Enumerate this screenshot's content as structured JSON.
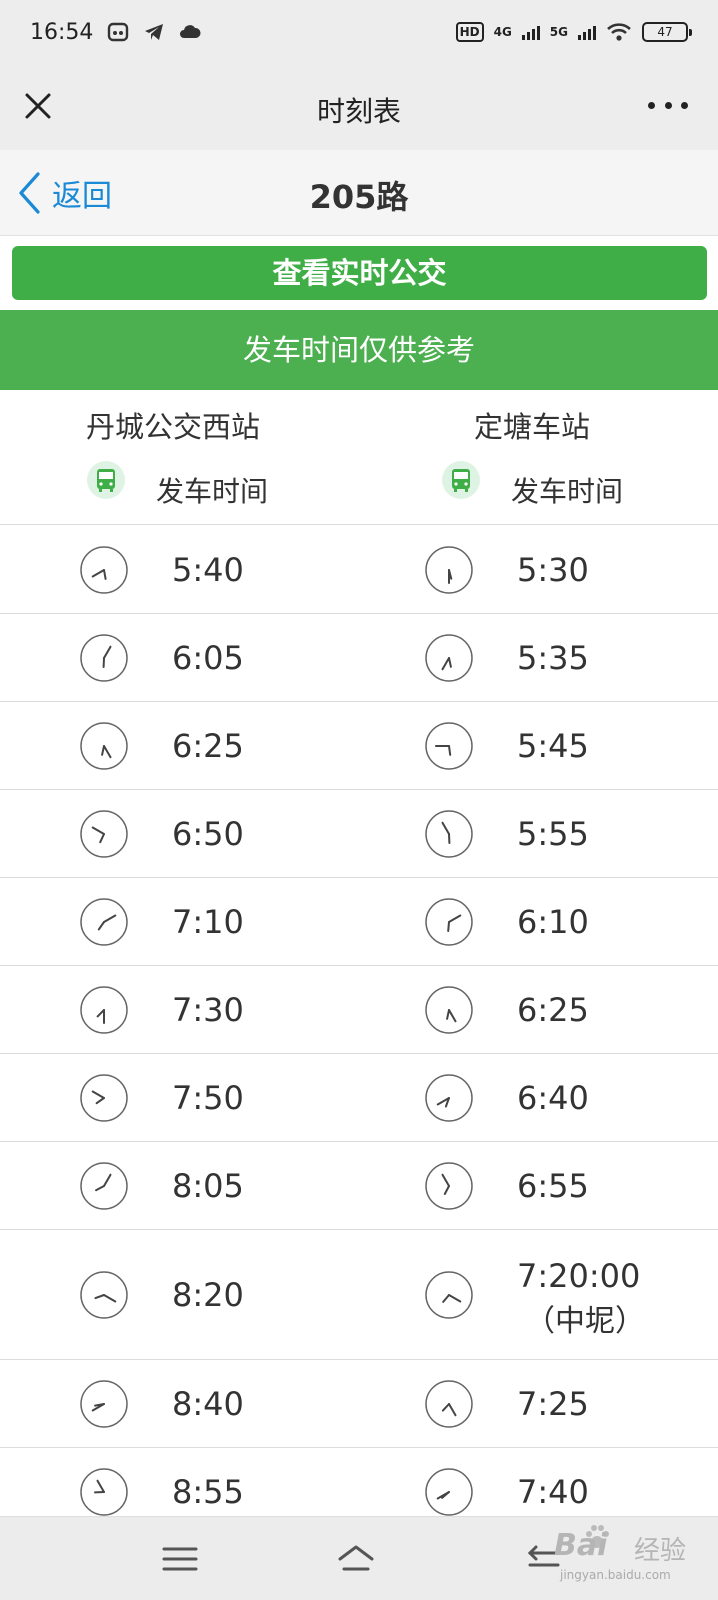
{
  "status_bar": {
    "time": "16:54",
    "hd": "HD",
    "network_1": "4G",
    "network_2": "5G",
    "battery": "47"
  },
  "title_bar": {
    "title": "时刻表",
    "close_icon": "close-icon",
    "more_icon": "more-icon"
  },
  "nav": {
    "back_label": "返回",
    "route": "205路"
  },
  "realtime_button": "查看实时公交",
  "notice": "发车时间仅供参考",
  "columns": [
    {
      "station": "丹城公交西站",
      "depart_label": "发车时间"
    },
    {
      "station": "定塘车站",
      "depart_label": "发车时间"
    }
  ],
  "rows": [
    {
      "left": "5:40",
      "right": "5:30"
    },
    {
      "left": "6:05",
      "right": "5:35"
    },
    {
      "left": "6:25",
      "right": "5:45"
    },
    {
      "left": "6:50",
      "right": "5:55"
    },
    {
      "left": "7:10",
      "right": "6:10"
    },
    {
      "left": "7:30",
      "right": "6:25"
    },
    {
      "left": "7:50",
      "right": "6:40"
    },
    {
      "left": "8:05",
      "right": "6:55"
    },
    {
      "left": "8:20",
      "right": "7:20:00",
      "right_note": "（中坭）"
    },
    {
      "left": "8:40",
      "right": "7:25"
    },
    {
      "left": "8:55",
      "right": "7:40"
    }
  ],
  "colors": {
    "accent_green": "#3fae47",
    "banner_green": "#4caf50",
    "link_blue": "#1a8ad6"
  },
  "watermark": {
    "logo": "Bai",
    "cn": "经验",
    "url": "jingyan.baidu.com"
  }
}
